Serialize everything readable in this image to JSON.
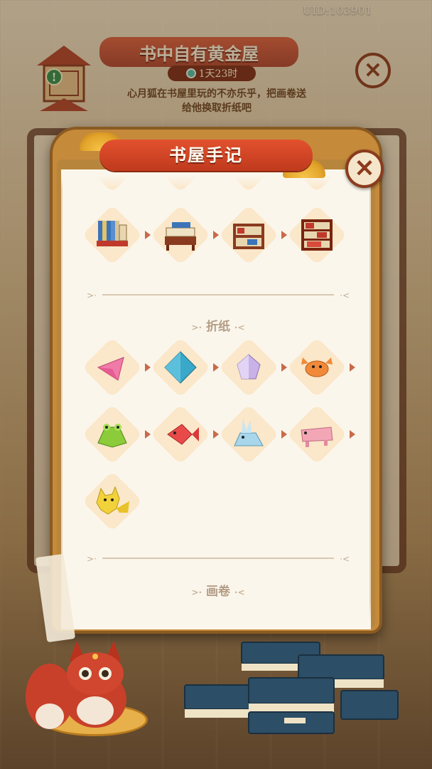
{
  "uid": "UID:103901",
  "event": {
    "title": "书中自有黄金屋",
    "timer": "1天23时",
    "description_line1": "心月狐在书屋里玩的不亦乐乎，把画卷送",
    "description_line2": "给他换取折纸吧"
  },
  "dialog": {
    "title": "书屋手记",
    "close_icon": "close-icon",
    "sections": [
      {
        "label": "",
        "items": [
          {
            "name": "book-stack-small",
            "icon": "books-icon"
          },
          {
            "name": "scroll-rack",
            "icon": "scroll-rack-icon"
          },
          {
            "name": "book-shelf-low",
            "icon": "shelf-icon"
          },
          {
            "name": "book-cabinet",
            "icon": "cabinet-icon"
          }
        ]
      },
      {
        "label": "折纸",
        "items": [
          {
            "name": "origami-triangle",
            "icon": "pink-triangle-icon",
            "color": "#f07aa8"
          },
          {
            "name": "origami-diamond",
            "icon": "blue-diamond-icon",
            "color": "#3aa8c8"
          },
          {
            "name": "origami-flower",
            "icon": "purple-flower-icon",
            "color": "#c8b2e8"
          },
          {
            "name": "origami-crab",
            "icon": "crab-icon",
            "color": "#f08a3a"
          },
          {
            "name": "origami-frog",
            "icon": "frog-icon",
            "color": "#8ccb3a"
          },
          {
            "name": "origami-fish",
            "icon": "fish-icon",
            "color": "#e84a4a"
          },
          {
            "name": "origami-rabbit",
            "icon": "rabbit-icon",
            "color": "#a8d6ea"
          },
          {
            "name": "origami-pig",
            "icon": "pig-icon",
            "color": "#f2a6b6"
          },
          {
            "name": "origami-cat",
            "icon": "cat-icon",
            "color": "#f2d23a"
          }
        ]
      },
      {
        "label": "画卷",
        "items": []
      }
    ]
  },
  "colors": {
    "accent_red": "#c03a1d",
    "frame_gold": "#c58a3a",
    "paper": "#fbf6ec",
    "tile": "#fbe7c9"
  }
}
